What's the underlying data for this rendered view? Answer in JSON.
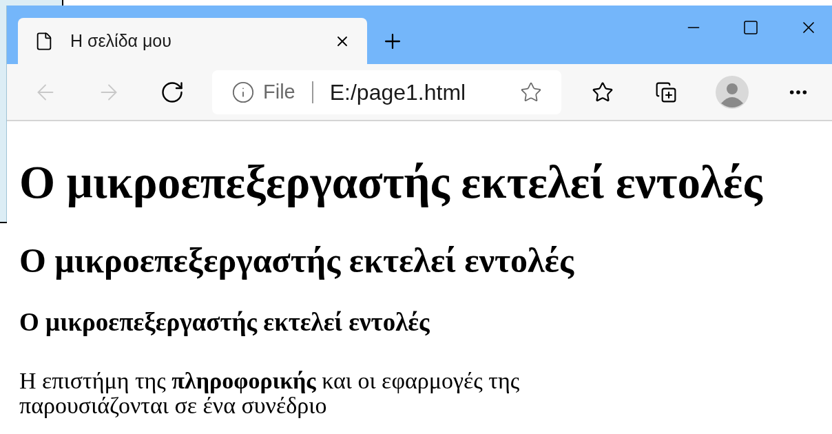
{
  "tabs": [
    {
      "title": "Η σελίδα μου",
      "selected": true
    }
  ],
  "toolbar": {
    "back": {
      "disabled": true
    },
    "forward": {
      "disabled": true
    }
  },
  "address_bar": {
    "scheme_label": "File",
    "url": "E:/page1.html"
  },
  "page": {
    "headings": [
      {
        "kind": "h1",
        "text": "Ο μικροεπεξεργαστής εκτελεί εντολές"
      },
      {
        "kind": "h2",
        "text": "Ο μικροεπεξεργαστής εκτελεί εντολές"
      },
      {
        "kind": "h3",
        "text": "Ο μικροεπεξεργαστής εκτελεί εντολές"
      }
    ],
    "paragraph": "Η επιστήμη της **πληροφορικής** και οι εφαρμογές της παρουσιάζονται σε ένα συνέδριο"
  }
}
